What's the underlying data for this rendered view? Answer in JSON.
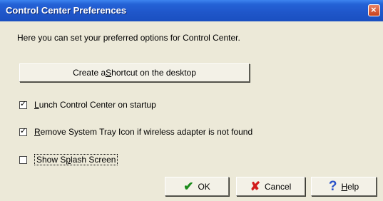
{
  "window": {
    "title": "Control Center Preferences",
    "close_glyph": "×"
  },
  "description": "Here you can set your preferred options for Control Center.",
  "shortcut_button": {
    "prefix": "Create a ",
    "accel": "S",
    "rest": "hortcut on the desktop"
  },
  "options": [
    {
      "accel": "L",
      "rest": "unch Control Center on startup",
      "checked": true
    },
    {
      "accel": "R",
      "rest": "emove System Tray Icon if wireless adapter is not found",
      "checked": true
    },
    {
      "prefix": "Show S",
      "accel": "p",
      "rest": "lash Screen",
      "checked": false
    }
  ],
  "buttons": {
    "ok": {
      "icon": "checkmark-icon",
      "glyph": "✔",
      "label": "OK"
    },
    "cancel": {
      "icon": "cancel-x-icon",
      "glyph": "✘",
      "label": "Cancel"
    },
    "help": {
      "icon": "help-question-icon",
      "glyph": "?",
      "accel": "H",
      "rest": "elp"
    }
  },
  "colors": {
    "titlebar": "#2462d6",
    "dialog_bg": "#ece9d8",
    "ok_icon": "#1c8b1c",
    "cancel_icon": "#d21b1b",
    "help_icon": "#2851c9"
  }
}
